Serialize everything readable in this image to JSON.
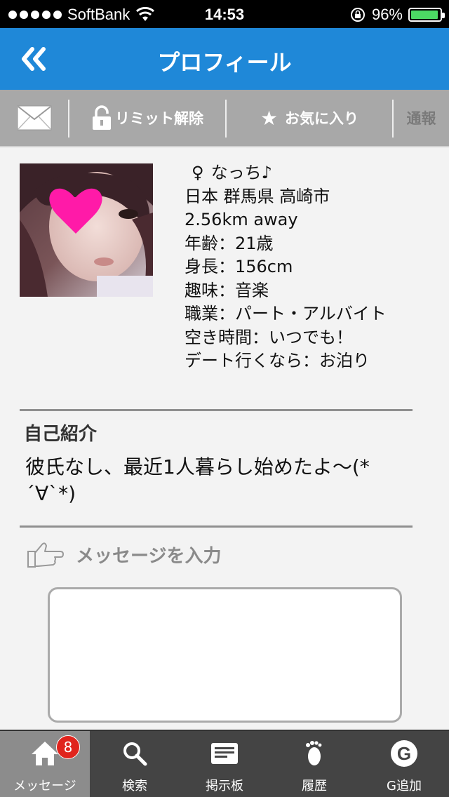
{
  "status_bar": {
    "carrier": "SoftBank",
    "time": "14:53",
    "battery_percent": "96%",
    "battery_level": 0.96,
    "accent_battery": "#4cd964"
  },
  "header": {
    "title": "プロフィール",
    "back_icon": "double-chevron-left-icon",
    "color": "#1f88d8"
  },
  "actions": {
    "mail_icon": "envelope-icon",
    "limit_label": "リミット解除",
    "favorite_label": "お気に入り",
    "report_label": "通報"
  },
  "profile": {
    "gender_icon": "female-sign-icon",
    "name": "なっち♪",
    "gender_symbol": "♀",
    "location": "日本 群馬県 高崎市",
    "distance": "2.56km away",
    "age": "年齢：21歳",
    "height": "身長：156cm",
    "hobby": "趣味：音楽",
    "job": "職業：パート・アルバイト",
    "free_time": "空き時間：いつでも！",
    "date": "デート行くなら：お泊り"
  },
  "intro": {
    "heading": "自己紹介",
    "text": "彼氏なし、最近1人暮らし始めたよ〜(*´∀`*)"
  },
  "message": {
    "label": "メッセージを入力",
    "icon": "pointing-hand-icon",
    "placeholder": ""
  },
  "tabs": [
    {
      "label": "メッセージ",
      "icon": "home-icon",
      "badge": "8",
      "active": true
    },
    {
      "label": "検索",
      "icon": "search-icon"
    },
    {
      "label": "掲示板",
      "icon": "board-icon"
    },
    {
      "label": "履歴",
      "icon": "footprint-icon"
    },
    {
      "label": "G追加",
      "icon": "g-circle-icon"
    }
  ]
}
